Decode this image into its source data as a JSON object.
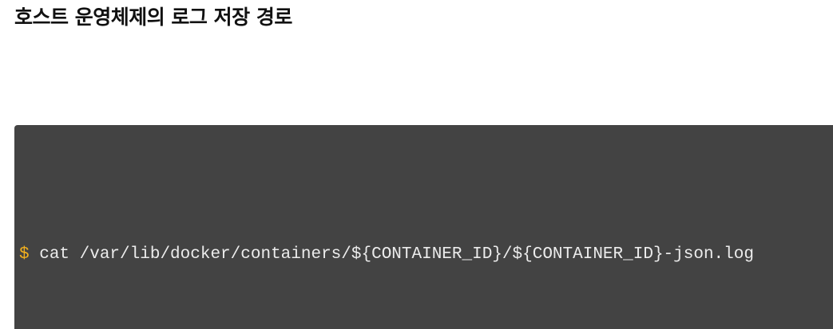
{
  "page": {
    "heading": "호스트 운영체제의 로그 저장 경로"
  },
  "code_block": {
    "prompt": "$",
    "command": "cat /var/lib/docker/containers/${CONTAINER_ID}/${CONTAINER_ID}-json.log",
    "colors": {
      "background": "#434343",
      "prompt": "#f2b01e",
      "text": "#ececec"
    }
  }
}
